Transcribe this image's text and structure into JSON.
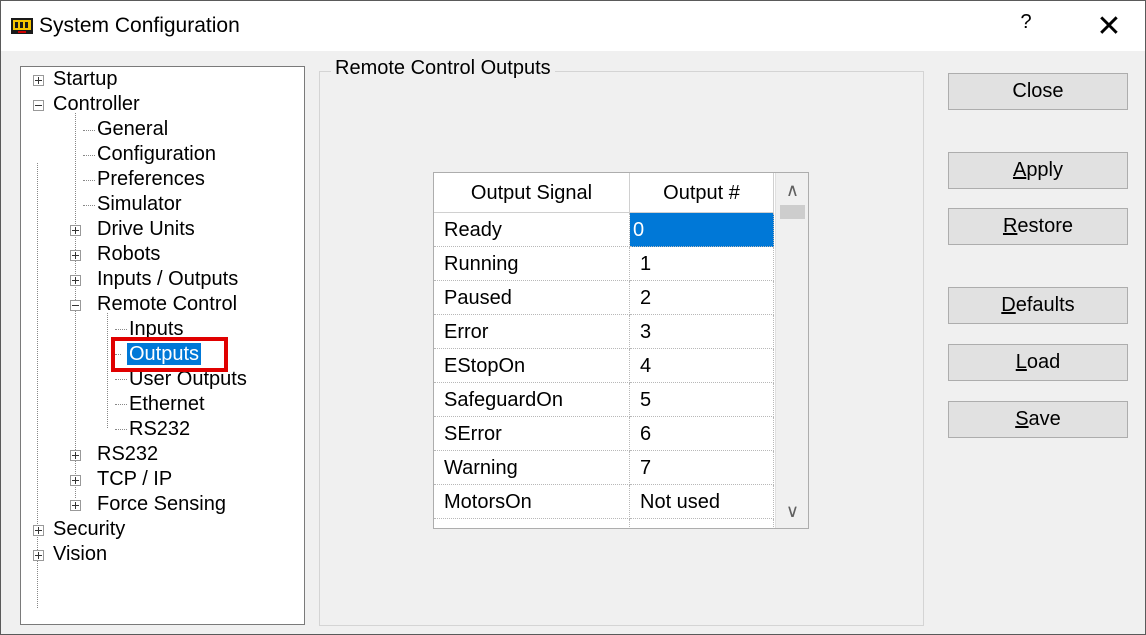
{
  "window": {
    "title": "System Configuration",
    "help": "?",
    "close_glyph": "✕",
    "icon": "system-config-icon"
  },
  "tree": {
    "items": [
      {
        "label": "Startup",
        "expander": "plus"
      },
      {
        "label": "Controller",
        "expander": "minus"
      },
      {
        "label": "General"
      },
      {
        "label": "Configuration"
      },
      {
        "label": "Preferences"
      },
      {
        "label": "Simulator"
      },
      {
        "label": "Drive Units",
        "expander": "plus"
      },
      {
        "label": "Robots",
        "expander": "plus"
      },
      {
        "label": "Inputs / Outputs",
        "expander": "plus"
      },
      {
        "label": "Remote Control",
        "expander": "minus"
      },
      {
        "label": "Inputs"
      },
      {
        "label": "Outputs",
        "selected": true
      },
      {
        "label": "User Outputs"
      },
      {
        "label": "Ethernet"
      },
      {
        "label": "RS232"
      },
      {
        "label": "RS232",
        "expander": "plus"
      },
      {
        "label": "TCP / IP",
        "expander": "plus"
      },
      {
        "label": "Force Sensing",
        "expander": "plus"
      },
      {
        "label": "Security",
        "expander": "plus"
      },
      {
        "label": "Vision",
        "expander": "plus"
      }
    ]
  },
  "group": {
    "title": "Remote Control Outputs"
  },
  "grid": {
    "headers": [
      "Output Signal",
      "Output #"
    ],
    "rows": [
      [
        "Ready",
        "0"
      ],
      [
        "Running",
        "1"
      ],
      [
        "Paused",
        "2"
      ],
      [
        "Error",
        "3"
      ],
      [
        "EStopOn",
        "4"
      ],
      [
        "SafeguardOn",
        "5"
      ],
      [
        "SError",
        "6"
      ],
      [
        "Warning",
        "7"
      ],
      [
        "MotorsOn",
        "Not used"
      ]
    ],
    "selected_row": 0,
    "scroll_up": "∧",
    "scroll_down": "∨"
  },
  "buttons": {
    "close": "Close",
    "apply_first": "A",
    "apply_rest": "pply",
    "restore_first": "R",
    "restore_rest": "estore",
    "defaults_first": "D",
    "defaults_rest": "efaults",
    "load_first": "L",
    "load_rest": "oad",
    "save_first": "S",
    "save_rest": "ave"
  },
  "colors": {
    "selection": "#0078d7",
    "highlight_box": "#e00000"
  }
}
